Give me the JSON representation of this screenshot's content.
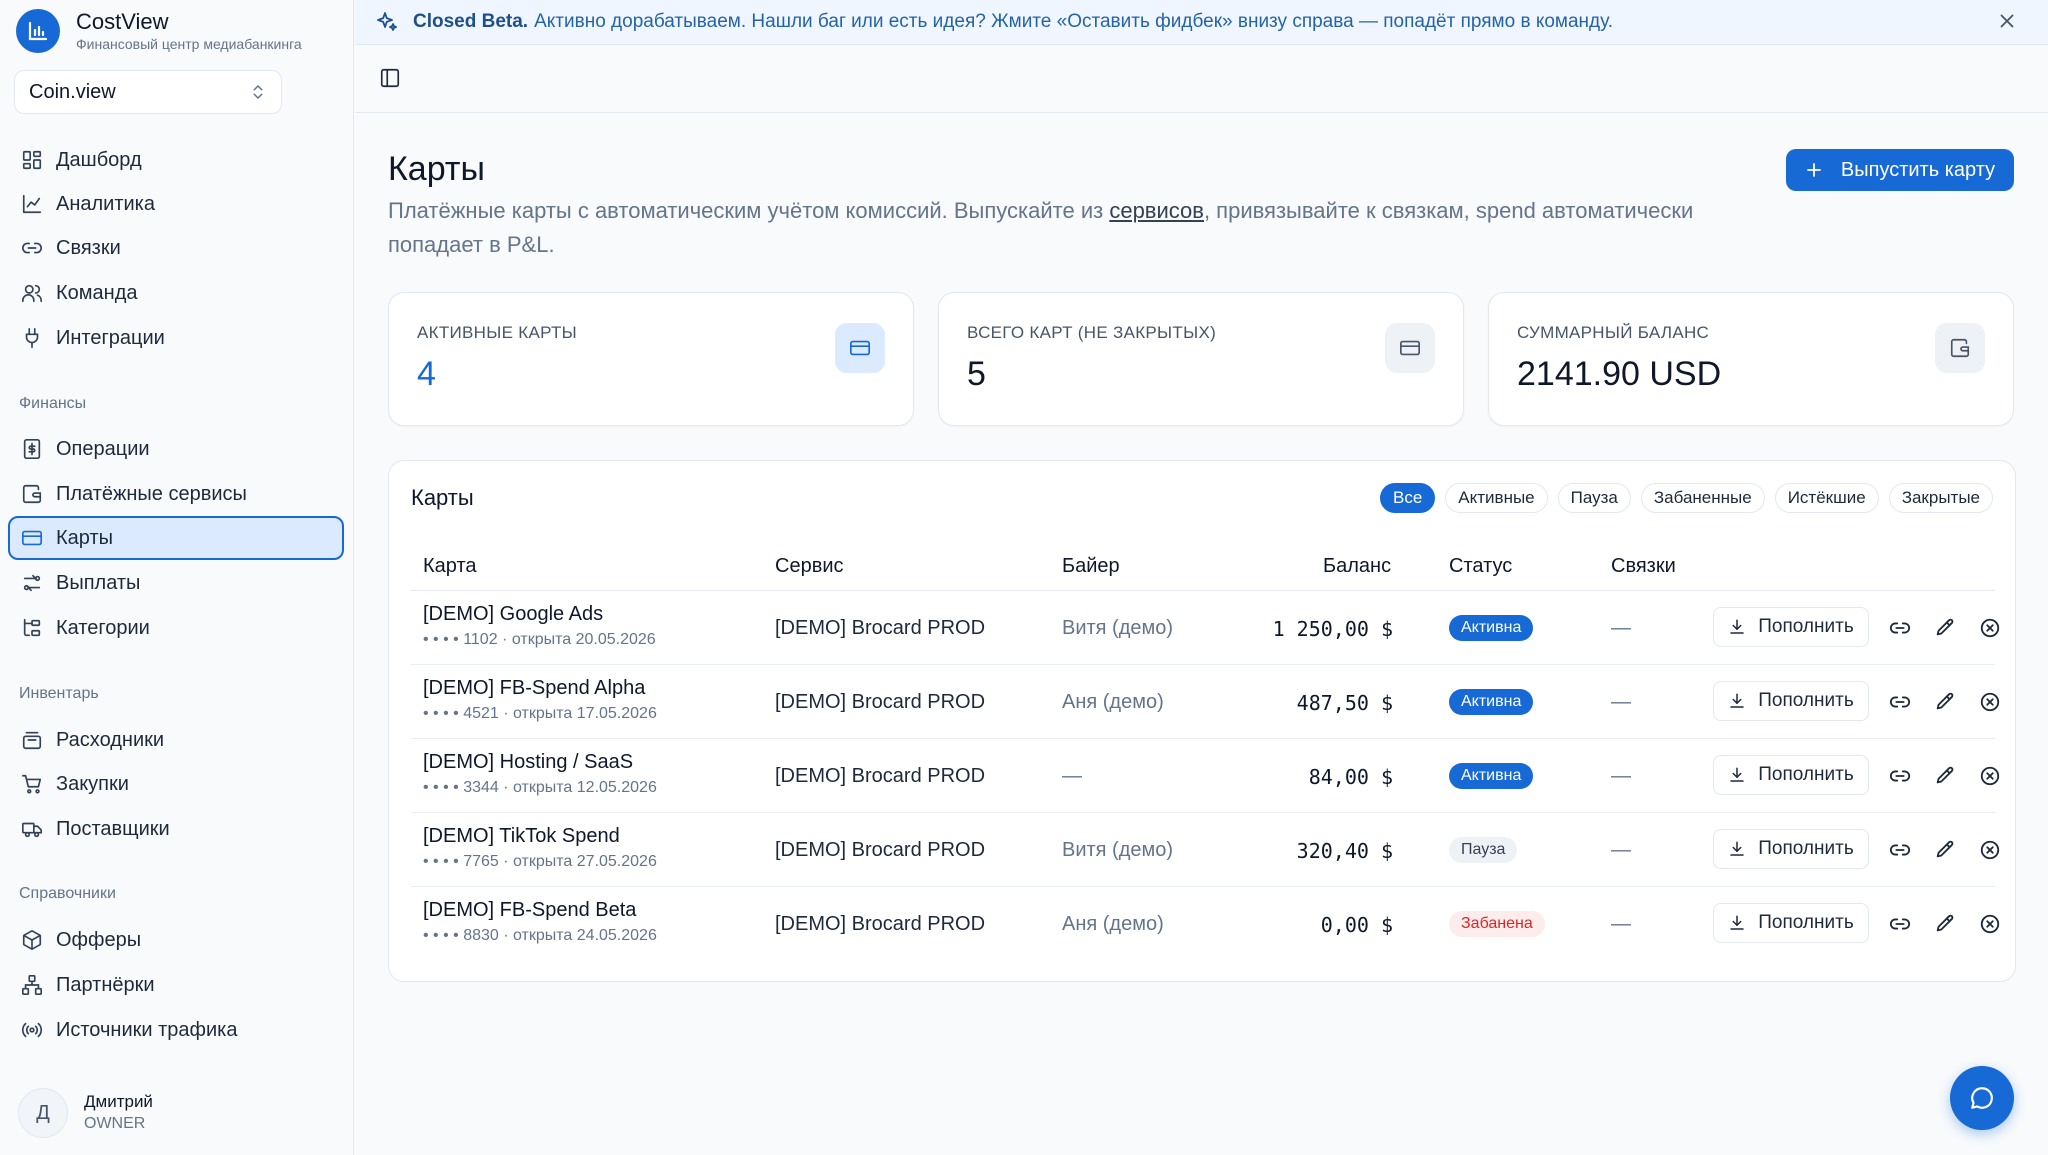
{
  "app": {
    "title": "CostView",
    "subtitle": "Финансовый центр медиабанкинга",
    "workspace": "Coin.view"
  },
  "sidebar": {
    "main_items": [
      {
        "label": "Дашборд",
        "icon": "dashboard-icon"
      },
      {
        "label": "Аналитика",
        "icon": "chart-line-icon"
      },
      {
        "label": "Связки",
        "icon": "link-icon"
      },
      {
        "label": "Команда",
        "icon": "users-icon"
      },
      {
        "label": "Интеграции",
        "icon": "plug-icon"
      }
    ],
    "sections": {
      "finance": "Финансы",
      "inventory": "Инвентарь",
      "reference": "Справочники"
    },
    "finance_items": [
      {
        "label": "Операции",
        "icon": "receipt-icon"
      },
      {
        "label": "Платёжные сервисы",
        "icon": "wallet-icon"
      },
      {
        "label": "Карты",
        "icon": "credit-card-icon",
        "active": true
      },
      {
        "label": "Выплаты",
        "icon": "payouts-icon"
      },
      {
        "label": "Категории",
        "icon": "categories-icon"
      }
    ],
    "inventory_items": [
      {
        "label": "Расходники",
        "icon": "stack-icon"
      },
      {
        "label": "Закупки",
        "icon": "cart-icon"
      },
      {
        "label": "Поставщики",
        "icon": "suppliers-icon"
      }
    ],
    "reference_items": [
      {
        "label": "Офферы",
        "icon": "box-icon"
      },
      {
        "label": "Партнёрки",
        "icon": "network-icon"
      },
      {
        "label": "Источники трафика",
        "icon": "broadcast-icon"
      }
    ],
    "user": {
      "initial": "Д",
      "name": "Дмитрий",
      "role": "OWNER"
    }
  },
  "banner": {
    "tag": "Closed Beta.",
    "message": "Активно дорабатываем. Нашли баг или есть идея? Жмите «Оставить фидбек» внизу справа — попадёт прямо в команду."
  },
  "page": {
    "title": "Карты",
    "description_before": "Платёжные карты с автоматическим учётом комиссий. Выпускайте из ",
    "description_link": "сервисов",
    "description_after": ", привязывайте к связкам, spend автоматически попадает в P&L.",
    "primary_button": "Выпустить карту"
  },
  "stats": [
    {
      "label": "АКТИВНЫЕ КАРТЫ",
      "value": "4",
      "icon": "credit-card-icon"
    },
    {
      "label": "ВСЕГО КАРТ (НЕ ЗАКРЫТЫХ)",
      "value": "5",
      "icon": "credit-card-icon"
    },
    {
      "label": "СУММАРНЫЙ БАЛАНС",
      "value": "2141.90 USD",
      "icon": "wallet-icon"
    }
  ],
  "table": {
    "title": "Карты",
    "filters": [
      "Все",
      "Активные",
      "Пауза",
      "Забаненные",
      "Истёкшие",
      "Закрытые"
    ],
    "active_filter": "Все",
    "columns": {
      "card": "Карта",
      "service": "Сервис",
      "buyer": "Байер",
      "balance": "Баланс",
      "status": "Статус",
      "links": "Связки"
    },
    "topup_label": "Пополнить",
    "rows": [
      {
        "name": "[DEMO] Google Ads",
        "meta": "• • • • 1102 · открыта 20.05.2026",
        "service": "[DEMO] Brocard PROD",
        "buyer": "Витя (демо)",
        "balance": "1 250,00 $",
        "status": "Активна",
        "status_type": "active",
        "links": "—"
      },
      {
        "name": "[DEMO] FB-Spend Alpha",
        "meta": "• • • • 4521 · открыта 17.05.2026",
        "service": "[DEMO] Brocard PROD",
        "buyer": "Аня (демо)",
        "balance": "487,50 $",
        "status": "Активна",
        "status_type": "active",
        "links": "—"
      },
      {
        "name": "[DEMO] Hosting / SaaS",
        "meta": "• • • • 3344 · открыта 12.05.2026",
        "service": "[DEMO] Brocard PROD",
        "buyer": "—",
        "balance": "84,00 $",
        "status": "Активна",
        "status_type": "active",
        "links": "—"
      },
      {
        "name": "[DEMO] TikTok Spend",
        "meta": "• • • • 7765 · открыта 27.05.2026",
        "service": "[DEMO] Brocard PROD",
        "buyer": "Витя (демо)",
        "balance": "320,40 $",
        "status": "Пауза",
        "status_type": "pause",
        "links": "—"
      },
      {
        "name": "[DEMO] FB-Spend Beta",
        "meta": "• • • • 8830 · открыта 24.05.2026",
        "service": "[DEMO] Brocard PROD",
        "buyer": "Аня (демо)",
        "balance": "0,00 $",
        "status": "Забанена",
        "status_type": "banned",
        "links": "—"
      }
    ]
  },
  "colors": {
    "accent": "#1769d6",
    "banned": "#dc2626",
    "muted": "#64748b"
  }
}
